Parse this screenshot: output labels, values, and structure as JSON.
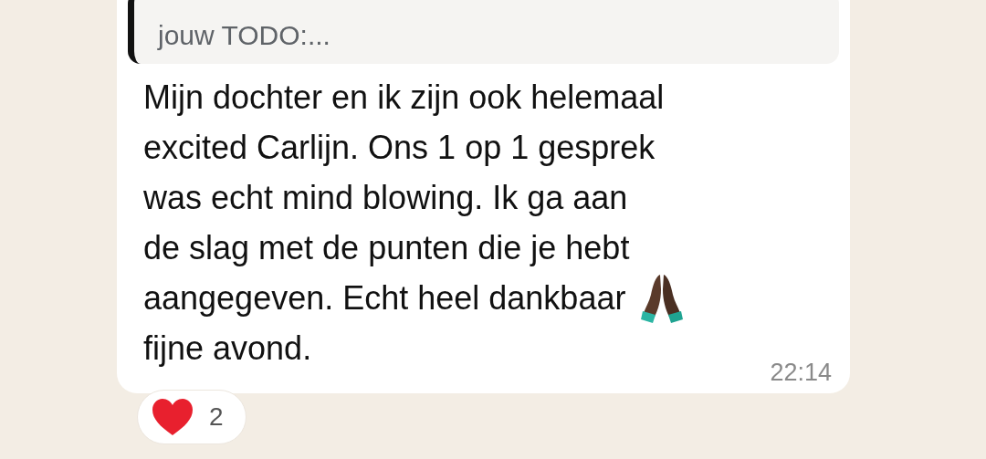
{
  "quoted_message": {
    "text": "jouw TODO:..."
  },
  "message": {
    "lines": [
      {
        "text": "Mijn dochter en ik zijn ook helemaal",
        "kind": "text"
      },
      {
        "text": "excited Carlijn. Ons 1 op 1 gesprek",
        "kind": "text"
      },
      {
        "text": "was echt mind blowing. Ik ga aan",
        "kind": "text"
      },
      {
        "text": "de slag met de punten die je hebt",
        "kind": "text"
      },
      {
        "text": "aangegeven. Echt heel dankbaar",
        "kind": "emoji"
      },
      {
        "text": "fijne avond.",
        "kind": "text"
      }
    ],
    "time": "22:14"
  },
  "reaction": {
    "count": "2"
  }
}
